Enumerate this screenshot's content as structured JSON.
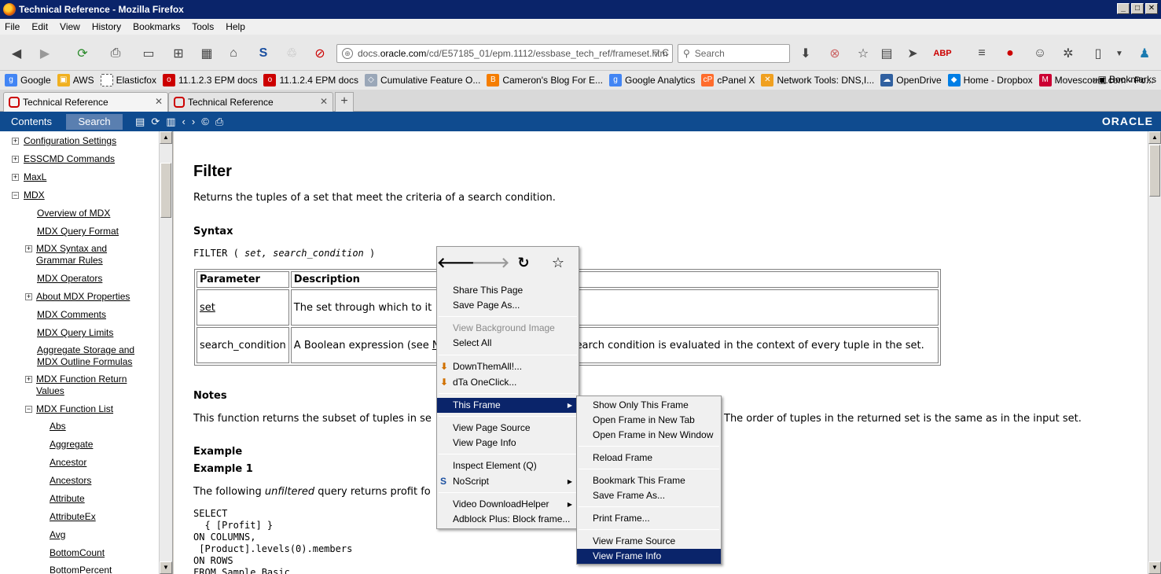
{
  "window": {
    "title": "Technical Reference - Mozilla Firefox",
    "buttons": [
      "_",
      "□",
      "✕"
    ]
  },
  "menubar": [
    "File",
    "Edit",
    "View",
    "History",
    "Bookmarks",
    "Tools",
    "Help"
  ],
  "urlbar": {
    "prefix": "docs.",
    "host": "oracle.com",
    "path": "/cd/E57185_01/epm.1112/essbase_tech_ref/frameset.htm",
    "controls": "▽ C"
  },
  "search": {
    "placeholder": "Search"
  },
  "bookmarks": [
    {
      "label": "Google",
      "color": "#4285f4",
      "glyph": "g"
    },
    {
      "label": "AWS",
      "color": "#f0b020",
      "glyph": "▣"
    },
    {
      "label": "Elasticfox",
      "color": "#ffffff",
      "glyph": ""
    },
    {
      "label": "11.1.2.3 EPM docs",
      "color": "#cc0000",
      "glyph": "o"
    },
    {
      "label": "11.1.2.4 EPM docs",
      "color": "#cc0000",
      "glyph": "o"
    },
    {
      "label": "Cumulative Feature O...",
      "color": "#9aa7b8",
      "glyph": "◇"
    },
    {
      "label": "Cameron's Blog For E...",
      "color": "#f57d00",
      "glyph": "B"
    },
    {
      "label": "Google Analytics",
      "color": "#4285f4",
      "glyph": "g"
    },
    {
      "label": "cPanel X",
      "color": "#ff6c2c",
      "glyph": "cP"
    },
    {
      "label": "Network Tools: DNS,I...",
      "color": "#f0a020",
      "glyph": "✕"
    },
    {
      "label": "OpenDrive",
      "color": "#3060a0",
      "glyph": "☁"
    },
    {
      "label": "Home - Dropbox",
      "color": "#007ee5",
      "glyph": "◆"
    },
    {
      "label": "Movescount.com - Po...",
      "color": "#cc0033",
      "glyph": "M"
    }
  ],
  "bookmarks_more": "»",
  "bookmarks_all": "Bookmarks",
  "tabs": [
    {
      "label": "Technical Reference",
      "close": "✕"
    },
    {
      "label": "Technical Reference",
      "close": "✕"
    }
  ],
  "newtab": "+",
  "help": {
    "tab_contents": "Contents",
    "tab_search": "Search",
    "icons": [
      "▤",
      "⟳",
      "▥",
      "‹",
      "›",
      "©",
      "⎙"
    ],
    "brand": "ORACLE"
  },
  "toc": [
    {
      "label": "Configuration Settings",
      "pm": "+"
    },
    {
      "label": "ESSCMD Commands",
      "pm": "+"
    },
    {
      "label": "MaxL",
      "pm": "+"
    },
    {
      "label": "MDX",
      "pm": "−"
    },
    {
      "label": "Overview of MDX"
    },
    {
      "label": "MDX Query Format"
    },
    {
      "label": "MDX Syntax and",
      "label2": "Grammar Rules",
      "pm": "+"
    },
    {
      "label": "MDX Operators"
    },
    {
      "label": "About MDX Properties",
      "pm": "+"
    },
    {
      "label": "MDX Comments"
    },
    {
      "label": "MDX Query Limits"
    },
    {
      "label": "Aggregate Storage and",
      "label2": "MDX Outline Formulas"
    },
    {
      "label": "MDX Function Return",
      "label2": "Values",
      "pm": "+"
    },
    {
      "label": "MDX Function List",
      "pm": "−"
    },
    {
      "label": "Abs"
    },
    {
      "label": "Aggregate"
    },
    {
      "label": "Ancestor"
    },
    {
      "label": "Ancestors"
    },
    {
      "label": "Attribute"
    },
    {
      "label": "AttributeEx"
    },
    {
      "label": "Avg"
    },
    {
      "label": "BottomCount"
    },
    {
      "label": "BottomPercent"
    }
  ],
  "article": {
    "title": "Filter",
    "summary": "Returns the tuples of a set that meet the criteria of a search condition.",
    "syntax_heading": "Syntax",
    "syntax_kw": "FILTER",
    "syntax_open": " ( ",
    "syntax_args": "set, search_condition",
    "syntax_close": " )",
    "table": {
      "headers": [
        "Parameter",
        "Description"
      ],
      "rows": [
        {
          "param": "set",
          "desc": "The set through which to it"
        },
        {
          "param": "search_condition",
          "desc_a": "A Boolean expression (see ",
          "desc_b": "N",
          "desc_c": "earch condition is evaluated in the context of every tuple in the set."
        }
      ]
    },
    "notes_heading": "Notes",
    "notes_a": "This function returns the subset of tuples in se",
    "notes_b": "The order of tuples in the returned set is the same as in the input set.",
    "example_heading": "Example",
    "example1_heading": "Example 1",
    "example1_a": "The following ",
    "example1_em": "unfiltered",
    "example1_b": " query returns profit fo",
    "code": "SELECT\n  { [Profit] }\nON COLUMNS,\n [Product].levels(0).members\nON ROWS\nFROM Sample.Basic"
  },
  "context_menu": {
    "nav": [
      "🡐",
      "🡒",
      "↻",
      "☆"
    ],
    "items": [
      {
        "label": "Share This Page"
      },
      {
        "label": "Save Page As..."
      },
      {
        "label": "View Background Image",
        "disabled": true
      },
      {
        "label": "Select All"
      },
      {
        "label": "DownThemAll!..."
      },
      {
        "label": "dTa OneClick..."
      },
      {
        "label": "This Frame",
        "submenu": true,
        "highlighted": true
      },
      {
        "label": "View Page Source"
      },
      {
        "label": "View Page Info"
      },
      {
        "label": "Inspect Element (Q)"
      },
      {
        "label": "NoScript",
        "submenu": true
      },
      {
        "label": "Video DownloadHelper",
        "submenu": true
      },
      {
        "label": "Adblock Plus: Block frame..."
      }
    ]
  },
  "frame_submenu": {
    "items": [
      {
        "label": "Show Only This Frame"
      },
      {
        "label": "Open Frame in New Tab"
      },
      {
        "label": "Open Frame in New Window"
      },
      {
        "label": "Reload Frame"
      },
      {
        "label": "Bookmark This Frame"
      },
      {
        "label": "Save Frame As..."
      },
      {
        "label": "Print Frame..."
      },
      {
        "label": "View Frame Source"
      },
      {
        "label": "View Frame Info",
        "highlighted": true
      }
    ]
  }
}
